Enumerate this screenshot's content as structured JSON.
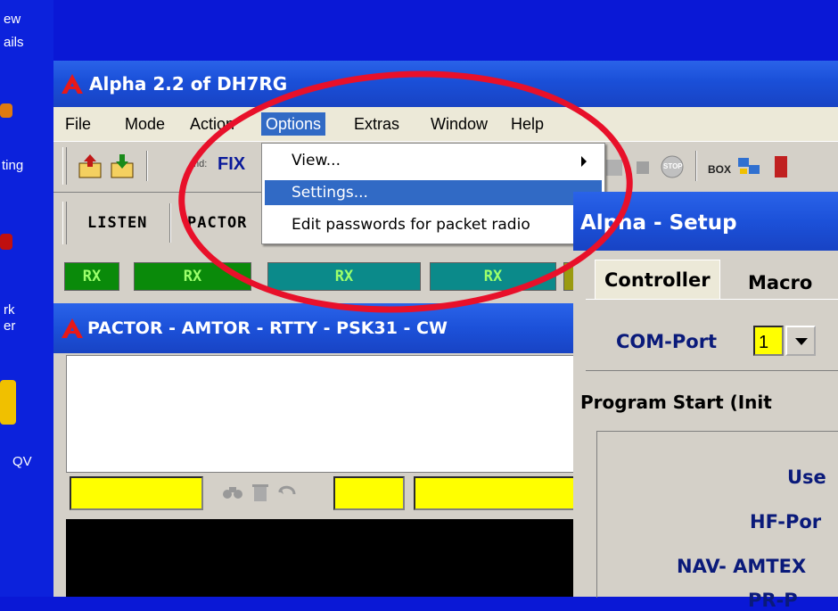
{
  "desktop": {
    "icon_labels": [
      "ew",
      "ails",
      "ting",
      "rk",
      "er",
      "QV"
    ]
  },
  "main_window": {
    "title": "Alpha 2.2 of DH7RG",
    "menu": [
      "File",
      "Mode",
      "Action",
      "Options",
      "Extras",
      "Window",
      "Help"
    ],
    "toolbar": {
      "cmd_label": "md:",
      "fix_label": "FIX"
    },
    "mode_buttons": [
      "LISTEN",
      "PACTOR"
    ],
    "rx_labels": [
      "RX",
      "RX",
      "RX",
      "RX"
    ],
    "box_icon_label": "BOX",
    "stop_label": "STOP"
  },
  "options_menu": {
    "items": [
      "View...",
      "Settings...",
      "Edit passwords for packet radio"
    ]
  },
  "sub_window": {
    "title": "PACTOR - AMTOR - RTTY - PSK31 - CW"
  },
  "setup_dialog": {
    "title": "Alpha - Setup",
    "tabs": [
      "Controller",
      "Macro"
    ],
    "com_port_label": "COM-Port",
    "com_port_value": "1",
    "program_start_label": "Program Start (Init",
    "fields": [
      "Use",
      "HF-Por",
      "NAV- AMTEX",
      "PR-P"
    ]
  },
  "colors": {
    "desktop": "#0a18d6",
    "title_bar": "#1c51d9",
    "menu_highlight": "#316ac5",
    "rx_green": "#0a8a0a",
    "rx_teal": "#0b8a8a",
    "yellow_field": "#ffff00",
    "annotation_red": "#e8102a"
  }
}
